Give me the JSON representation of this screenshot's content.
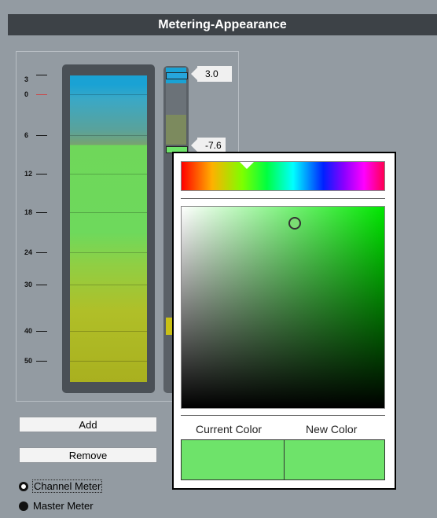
{
  "window": {
    "title": "Metering-Appearance"
  },
  "scale": {
    "labels": [
      "3",
      "0",
      "6",
      "12",
      "18",
      "24",
      "30",
      "40",
      "50"
    ]
  },
  "meter": {
    "top_value": "3.0",
    "mid_value": "-7.6"
  },
  "buttons": {
    "add": "Add",
    "remove": "Remove"
  },
  "meter_type": {
    "channel": "Channel Meter",
    "master": "Master Meter",
    "selected": "Master Meter"
  },
  "color_picker": {
    "current_label": "Current Color",
    "new_label": "New Color",
    "current_color": "#6ee36a",
    "new_color": "#6ee36a",
    "hue_color": "#00e600"
  },
  "colors": {
    "titlebar": "#3d4247",
    "background": "#939ba2",
    "meter_blue": "#1aa2d4",
    "meter_green": "#6ed95c",
    "meter_yellow": "#a9b01f"
  }
}
